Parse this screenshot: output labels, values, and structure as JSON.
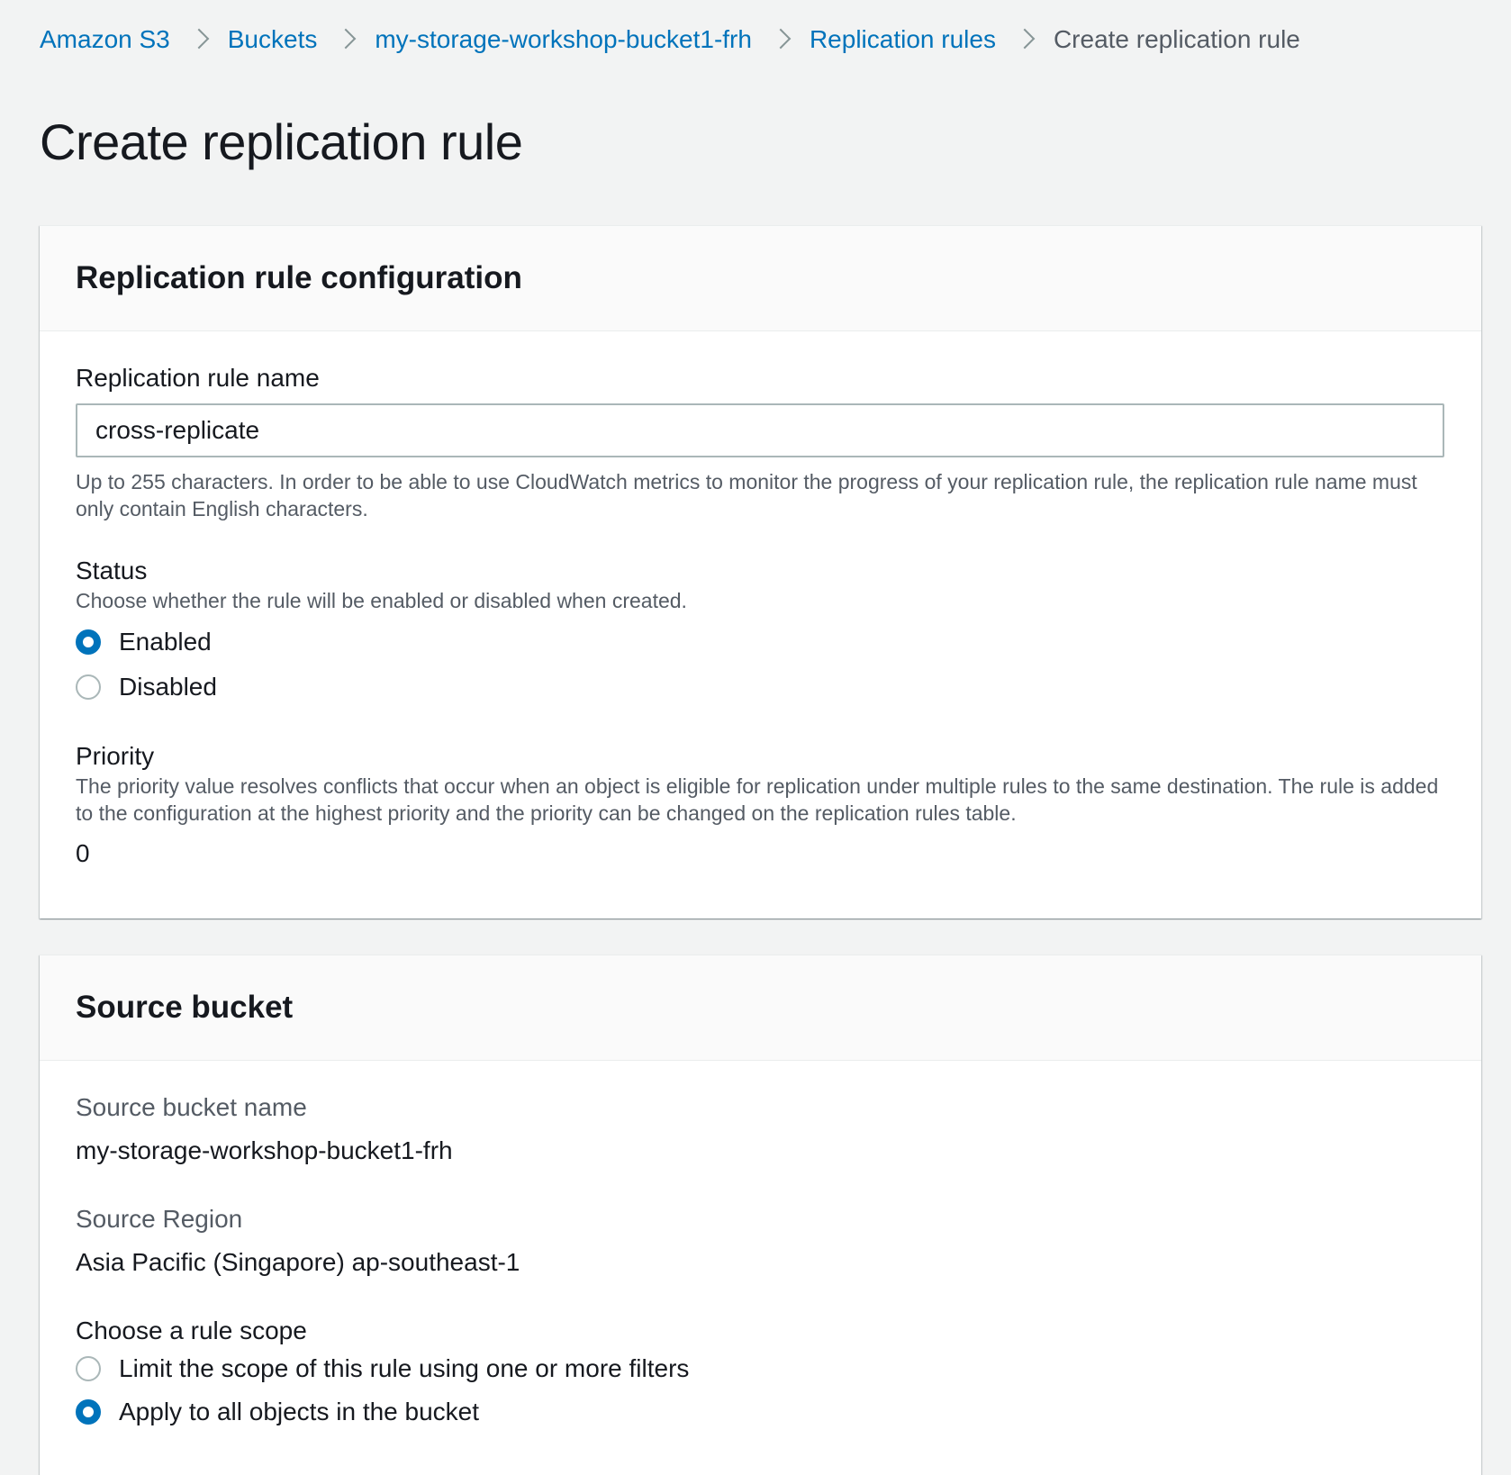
{
  "breadcrumb": {
    "items": [
      {
        "label": "Amazon S3"
      },
      {
        "label": "Buckets"
      },
      {
        "label": "my-storage-workshop-bucket1-frh"
      },
      {
        "label": "Replication rules"
      }
    ],
    "current": "Create replication rule"
  },
  "page": {
    "title": "Create replication rule"
  },
  "rule_config": {
    "title": "Replication rule configuration",
    "name_label": "Replication rule name",
    "name_value": "cross-replicate",
    "name_help": "Up to 255 characters. In order to be able to use CloudWatch metrics to monitor the progress of your replication rule, the replication rule name must only contain English characters.",
    "status_label": "Status",
    "status_desc": "Choose whether the rule will be enabled or disabled when created.",
    "status_options": [
      {
        "label": "Enabled",
        "checked": true
      },
      {
        "label": "Disabled",
        "checked": false
      }
    ],
    "priority_label": "Priority",
    "priority_desc": "The priority value resolves conflicts that occur when an object is eligible for replication under multiple rules to the same destination. The rule is added to the configuration at the highest priority and the priority can be changed on the replication rules table.",
    "priority_value": "0"
  },
  "source_bucket": {
    "title": "Source bucket",
    "name_label": "Source bucket name",
    "name_value": "my-storage-workshop-bucket1-frh",
    "region_label": "Source Region",
    "region_value": "Asia Pacific (Singapore) ap-southeast-1",
    "scope_label": "Choose a rule scope",
    "scope_options": [
      {
        "label": "Limit the scope of this rule using one or more filters",
        "checked": false
      },
      {
        "label": "Apply to all objects in the bucket",
        "checked": true
      }
    ]
  },
  "colors": {
    "link": "#0073bb",
    "radio_selected": "#0073bb",
    "background": "#f2f3f3"
  }
}
